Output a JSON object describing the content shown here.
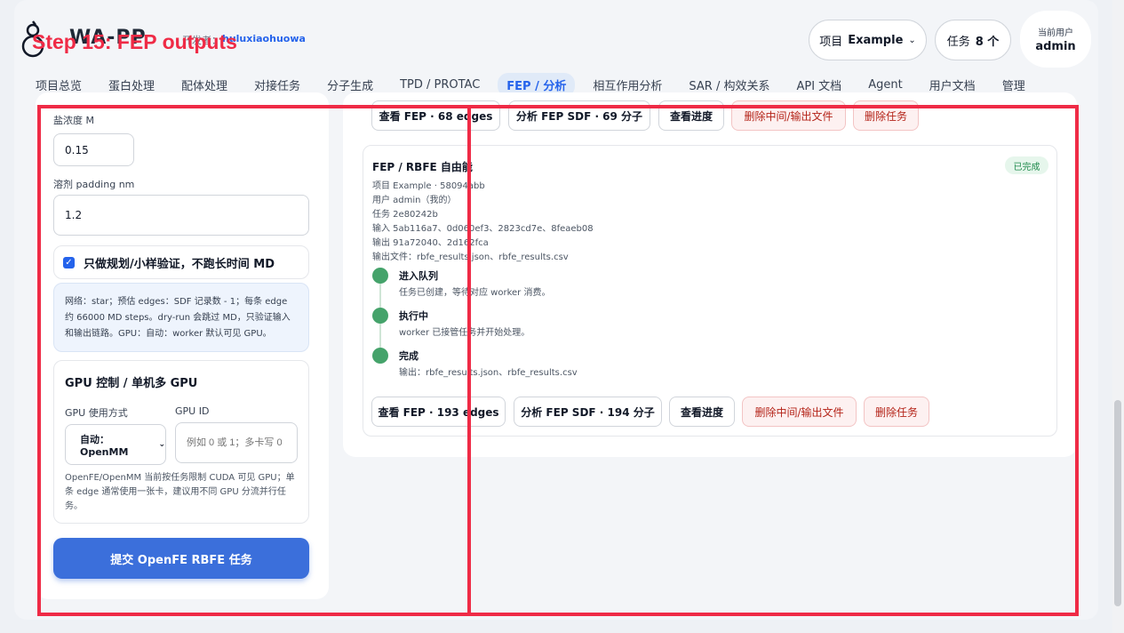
{
  "app": {
    "brand": "WA-PP",
    "developer_label": "开发者：",
    "developer_name": "huluxiaohuowa",
    "step_overlay": "Step 15: FEP outputs"
  },
  "header": {
    "project_label": "项目",
    "project_value": "Example",
    "tasks_label": "任务",
    "tasks_count": "8 个",
    "user_label": "当前用户",
    "user_name": "admin"
  },
  "nav": {
    "items": [
      {
        "label": "项目总览"
      },
      {
        "label": "蛋白处理"
      },
      {
        "label": "配体处理"
      },
      {
        "label": "对接任务"
      },
      {
        "label": "分子生成"
      },
      {
        "label": "TPD / PROTAC"
      },
      {
        "label": "FEP / 分析"
      },
      {
        "label": "相互作用分析"
      },
      {
        "label": "SAR / 构效关系"
      },
      {
        "label": "API 文档"
      },
      {
        "label": "Agent"
      },
      {
        "label": "用户文档"
      },
      {
        "label": "管理"
      }
    ]
  },
  "form": {
    "salt_label": "盐浓度 M",
    "salt_value": "0.15",
    "padding_label": "溶剂 padding nm",
    "padding_value": "1.2",
    "dryrun_label": "只做规划/小样验证，不跑长时间 MD",
    "dryrun_checked": true,
    "network_note": "网络：star；预估 edges：SDF 记录数 - 1；每条 edge 约 66000 MD steps。dry-run 会跳过 MD，只验证输入和输出链路。GPU：自动：worker 默认可见 GPU。",
    "gpu_title": "GPU 控制 / 单机多 GPU",
    "gpu_mode_label": "GPU 使用方式",
    "gpu_mode_value": "自动：OpenMM",
    "gpu_id_label": "GPU ID",
    "gpu_id_placeholder": "例如 0 或 1；多卡写 0",
    "gpu_note": "OpenFE/OpenMM 当前按任务限制 CUDA 可见 GPU；单条 edge 通常使用一张卡，建议用不同 GPU 分流并行任务。",
    "submit_label": "提交 OpenFE RBFE 任务"
  },
  "prev_job_buttons": {
    "view_fep": "查看 FEP · 68 edges",
    "analyze_sdf": "分析 FEP SDF · 69 分子",
    "view_progress": "查看进度",
    "delete_files": "删除中间/输出文件",
    "delete_task": "删除任务"
  },
  "job": {
    "title": "FEP / RBFE 自由能",
    "status": "已完成",
    "project_line": "项目 Example · 58094abb",
    "user_line": "用户 admin（我的）",
    "task_line": "任务 2e80242b",
    "input_line": "输入 5ab116a7、0d060ef3、2823cd7e、8feaeb08",
    "output_line": "输出 91a72040、2d162fca",
    "files_line": "输出文件：rbfe_results.json、rbfe_results.csv",
    "timeline": [
      {
        "title": "进入队列",
        "desc": "任务已创建，等待对应 worker 消费。"
      },
      {
        "title": "执行中",
        "desc": "worker 已接管任务并开始处理。"
      },
      {
        "title": "完成",
        "desc": "输出：rbfe_results.json、rbfe_results.csv"
      }
    ],
    "buttons": {
      "view_fep": "查看 FEP · 193 edges",
      "analyze_sdf": "分析 FEP SDF · 194 分子",
      "view_progress": "查看进度",
      "delete_files": "删除中间/输出文件",
      "delete_task": "删除任务"
    }
  },
  "colors": {
    "accent": "#3b6fdb",
    "annotation": "#ef2b46",
    "success": "#45a36b",
    "danger": "#b42318"
  }
}
